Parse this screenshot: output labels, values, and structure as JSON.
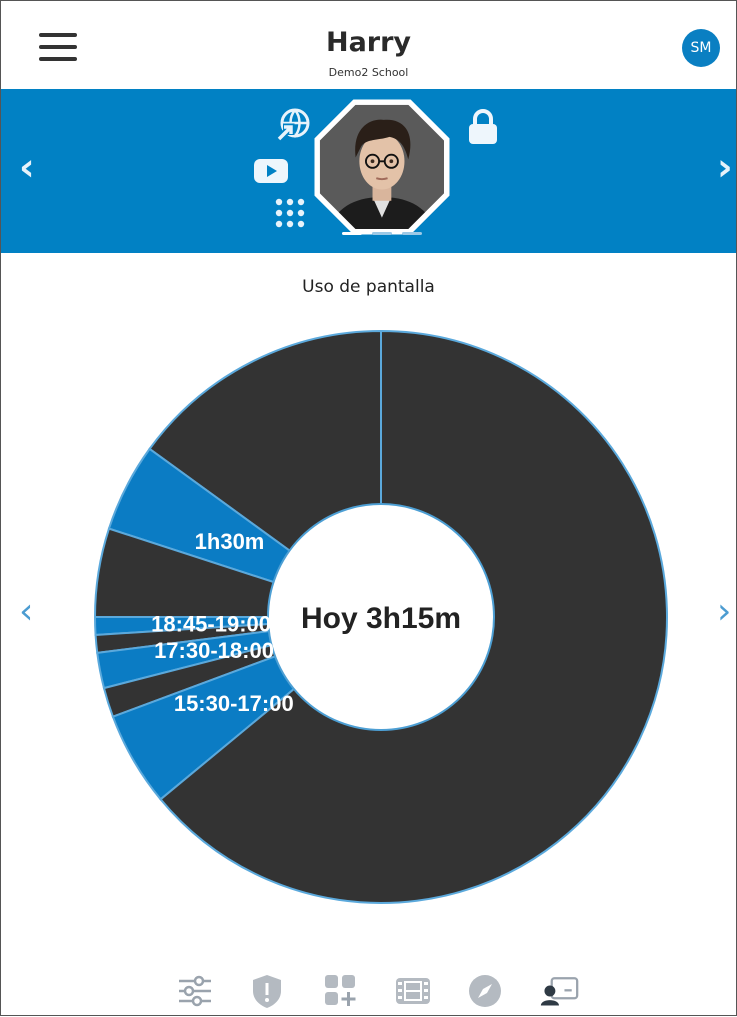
{
  "header": {
    "title": "Harry",
    "subtitle": "Demo2 School",
    "avatar_initials": "SM"
  },
  "banner": {
    "background": "#0181c4",
    "icons": [
      "globe-redirect-icon",
      "youtube-icon",
      "apps-grid-icon",
      "lock-icon"
    ]
  },
  "main": {
    "section_title": "Uso de pantalla",
    "center_label": "Hoy 3h15m"
  },
  "chart_data": {
    "type": "pie",
    "total_label": "Hoy 3h15m",
    "slices": [
      {
        "label": "",
        "minutes": 45,
        "color": "#333333"
      },
      {
        "label": "1h30m",
        "minutes": 15,
        "color": "#0b7cc4"
      },
      {
        "label": "",
        "minutes": 15,
        "color": "#333333"
      },
      {
        "label": "18:45-19:00",
        "minutes": 3,
        "color": "#0b7cc4"
      },
      {
        "label": "",
        "minutes": 3,
        "color": "#333333"
      },
      {
        "label": "17:30-18:00",
        "minutes": 6,
        "color": "#0b7cc4"
      },
      {
        "label": "",
        "minutes": 5,
        "color": "#333333"
      },
      {
        "label": "15:30-17:00",
        "minutes": 16,
        "color": "#0b7cc4"
      },
      {
        "label": "",
        "minutes": 192,
        "color": "#333333"
      }
    ]
  },
  "bottom_tabs": [
    "settings-sliders-icon",
    "shield-alert-icon",
    "add-app-icon",
    "film-icon",
    "compass-icon",
    "user-screen-icon"
  ]
}
